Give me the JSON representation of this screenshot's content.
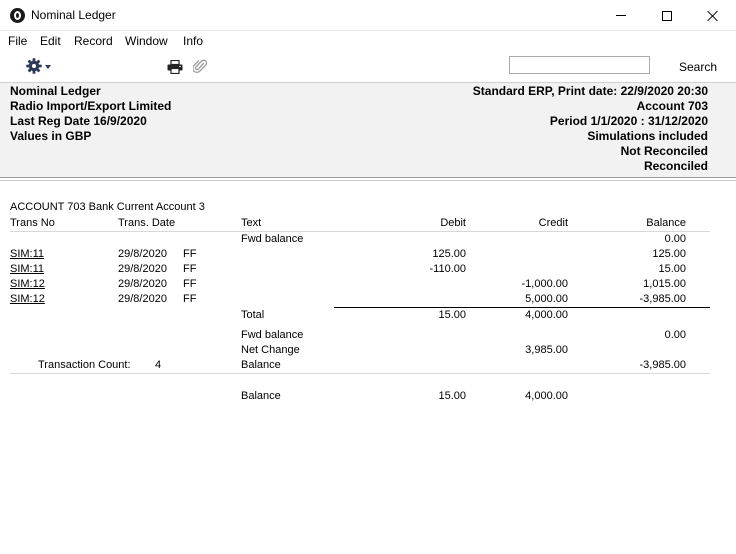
{
  "window": {
    "title": "Nominal Ledger"
  },
  "menu": [
    "File",
    "Edit",
    "Record",
    "Window",
    "Info"
  ],
  "toolbar": {
    "search_label": "Search",
    "search_value": ""
  },
  "header": {
    "report_name": "Nominal Ledger",
    "company": "Radio Import/Export Limited",
    "last_reg_date": "Last Reg Date  16/9/2020",
    "values_in": "Values in GBP",
    "print_info": "Standard ERP, Print date: 22/9/2020 20:30",
    "account": "Account  703",
    "period": "Period  1/1/2020 : 31/12/2020",
    "simulations": "Simulations included",
    "not_reconciled": "Not Reconciled",
    "reconciled": "Reconciled"
  },
  "report": {
    "account_title": "ACCOUNT 703  Bank Current Account 3",
    "columns": {
      "trans_no": "Trans No",
      "trans_date": "Trans. Date",
      "text": "Text",
      "debit": "Debit",
      "credit": "Credit",
      "balance": "Balance"
    },
    "fwd_balance": {
      "text": "Fwd balance",
      "balance": "0.00"
    },
    "rows": [
      {
        "trans_no": "SIM:11",
        "date": "29/8/2020",
        "type": "FF",
        "debit": "125.00",
        "credit": "",
        "balance": "125.00"
      },
      {
        "trans_no": "SIM:11",
        "date": "29/8/2020",
        "type": "FF",
        "debit": "-110.00",
        "credit": "",
        "balance": "15.00"
      },
      {
        "trans_no": "SIM:12",
        "date": "29/8/2020",
        "type": "FF",
        "debit": "",
        "credit": "-1,000.00",
        "balance": "1,015.00"
      },
      {
        "trans_no": "SIM:12",
        "date": "29/8/2020",
        "type": "FF",
        "debit": "",
        "credit": "5,000.00",
        "balance": "-3,985.00"
      }
    ],
    "total": {
      "label": "Total",
      "debit": "15.00",
      "credit": "4,000.00"
    },
    "summary": {
      "fwd_label": "Fwd balance",
      "fwd_balance": "0.00",
      "net_change_label": "Net Change",
      "net_change_credit": "3,985.00",
      "balance_label": "Balance",
      "balance": "-3,985.00",
      "transaction_count_label": "Transaction Count:",
      "transaction_count": "4"
    },
    "grand": {
      "label": "Balance",
      "debit": "15.00",
      "credit": "4,000.00"
    }
  }
}
